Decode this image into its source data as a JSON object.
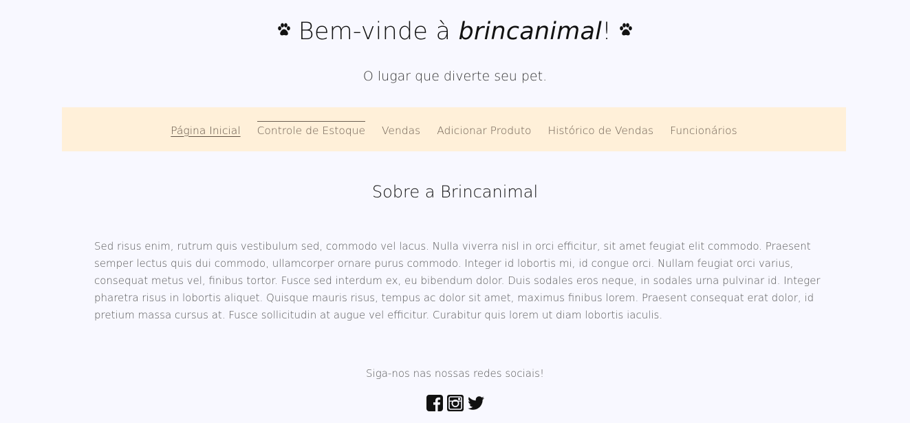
{
  "header": {
    "title_prefix": "Bem-vinde à ",
    "title_brand": "brincanimal",
    "title_suffix": "!",
    "tagline": "O lugar que diverte seu pet.",
    "icons": [
      "paw-icon",
      "paw-icon"
    ]
  },
  "nav": {
    "items": [
      {
        "label": "Página Inicial",
        "state": "active"
      },
      {
        "label": "Controle de Estoque",
        "state": "hovered"
      },
      {
        "label": "Vendas"
      },
      {
        "label": "Adicionar Produto"
      },
      {
        "label": "Histórico de Vendas"
      },
      {
        "label": "Funcionários"
      }
    ],
    "background": "#fff0d9"
  },
  "main": {
    "section_title": "Sobre a Brincanimal",
    "about_text": "Sed risus enim, rutrum quis vestibulum sed, commodo vel lacus. Nulla viverra nisl in orci efficitur, sit amet feugiat elit commodo. Praesent semper lectus quis dui commodo, ullamcorper ornare purus commodo. Integer id lobortis mi, id congue orci. Nullam feugiat orci varius, consequat metus vel, finibus tortor. Fusce sed interdum ex, eu bibendum dolor. Duis sodales eros neque, in sodales urna pulvinar id. Integer pharetra risus in lobortis aliquet. Quisque mauris risus, tempus ac dolor sit amet, maximus finibus lorem. Praesent consequat erat dolor, id pretium massa cursus at. Fusce sollicitudin at augue vel efficitur. Curabitur quis lorem ut diam lobortis iaculis."
  },
  "footer": {
    "social_label": "Siga-nos nas nossas redes sociais!",
    "social_icons": [
      "facebook-icon",
      "instagram-icon",
      "twitter-icon"
    ]
  },
  "colors": {
    "page_background": "#f8f8ff",
    "nav_link": "#6b5d50"
  }
}
